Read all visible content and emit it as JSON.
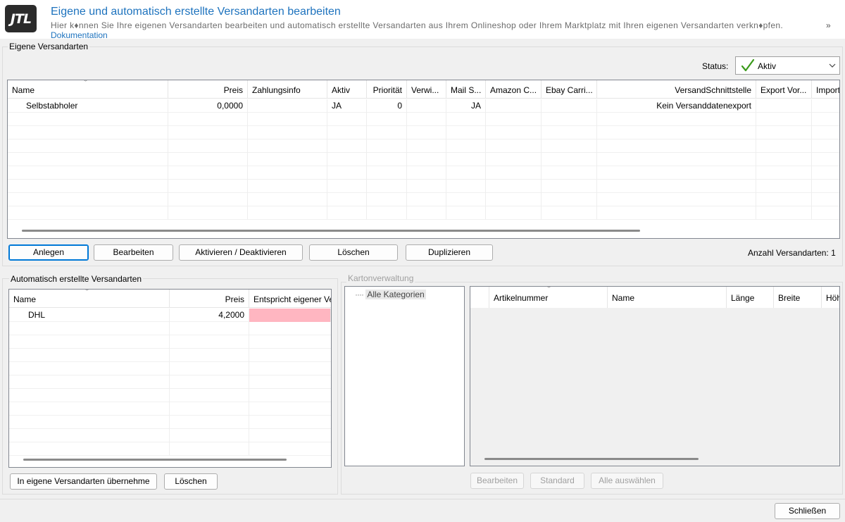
{
  "header": {
    "logo_text": "JTL",
    "title": "Eigene und automatisch erstellte Versandarten bearbeiten",
    "description": "Hier k♦nnen Sie Ihre eigenen Versandarten bearbeiten und automatisch erstellte Versandarten aus Ihrem Onlineshop oder Ihrem Marktplatz mit Ihren eigenen Versandarten verkn♦pfen.",
    "link": "Dokumentation",
    "more": "»"
  },
  "eigene": {
    "group_title": "Eigene Versandarten",
    "status_label": "Status:",
    "status_value": "Aktiv",
    "columns": [
      "Name",
      "Preis",
      "Zahlungsinfo",
      "Aktiv",
      "Priorität",
      "Verwi...",
      "Mail S...",
      "Amazon C...",
      "Ebay Carri...",
      "VersandSchnittstelle",
      "Export Vor...",
      "Import"
    ],
    "rows": [
      [
        "Selbstabholer",
        "0,0000",
        "",
        "JA",
        "0",
        "",
        "JA",
        "",
        "",
        "Kein Versanddatenexport",
        "",
        ""
      ]
    ],
    "buttons": {
      "anlegen": "Anlegen",
      "bearbeiten": "Bearbeiten",
      "aktivieren": "Aktivieren / Deaktivieren",
      "loeschen": "Löschen",
      "duplizieren": "Duplizieren"
    },
    "count_label": "Anzahl Versandarten: 1"
  },
  "auto": {
    "group_title": "Automatisch erstellte Versandarten",
    "columns": [
      "Name",
      "Preis",
      "Entspricht eigener Ve"
    ],
    "rows": [
      [
        "DHL",
        "4,2000",
        ""
      ]
    ],
    "buttons": {
      "uebernehmen": "In eigene Versandarten übernehme",
      "loeschen": "Löschen"
    }
  },
  "karton": {
    "group_title": "Kartonverwaltung",
    "tree_dots": "····",
    "tree_item": "Alle Kategorien",
    "columns": [
      "",
      "Artikelnummer",
      "Name",
      "Länge",
      "Breite",
      "Höhe"
    ],
    "buttons": {
      "bearbeiten": "Bearbeiten",
      "standard": "Standard",
      "alle": "Alle auswählen"
    }
  },
  "footer": {
    "schliessen": "Schließen"
  },
  "colors": {
    "title_blue": "#1e73be",
    "check_green": "#3a9a1a",
    "mismatch_pink": "#ffb6c1"
  }
}
